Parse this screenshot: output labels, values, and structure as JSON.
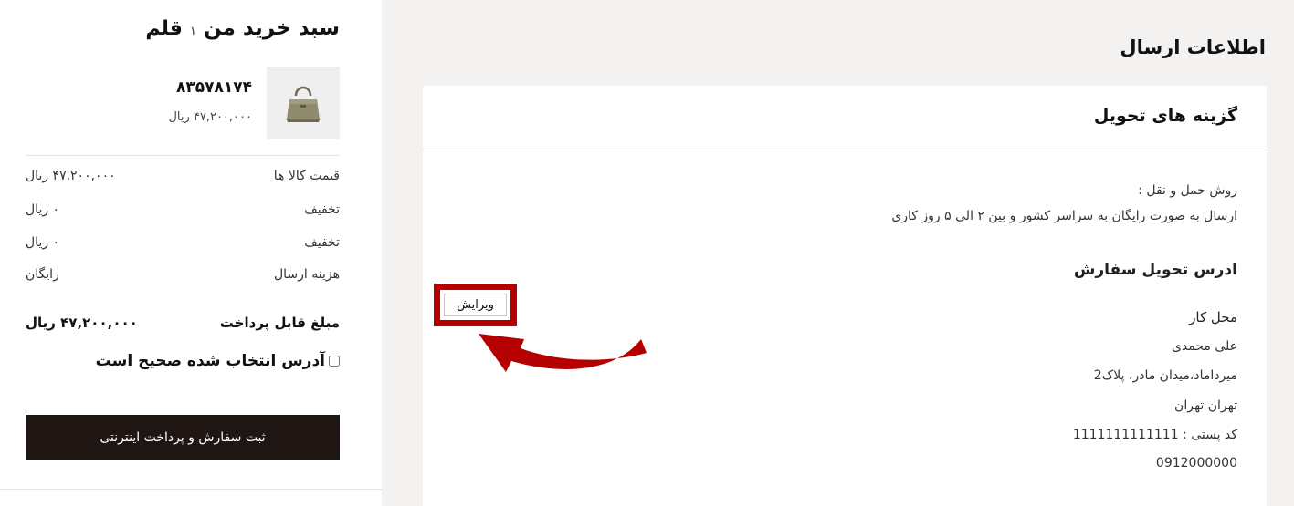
{
  "shipping": {
    "section_title": "اطلاعات ارسال",
    "card_title": "گزینه های تحویل",
    "method_label": "روش حمل و نقل :",
    "method_desc": "ارسال به صورت رایگان به سراسر کشور و بین ۲ الی ۵ روز کاری",
    "address_title": "ادرس تحویل سفارش",
    "address_lines": [
      "محل کار",
      "علی محمدی",
      "میرداماد،میدان مادر، پلاک2",
      "تهران تهران",
      "کد پستی : 1111111111111",
      "0912000000"
    ],
    "edit_label": "ویرایش"
  },
  "cart": {
    "title": "سبد خرید من",
    "count": "۱",
    "unit": "قلم",
    "product": {
      "code": "۸۳۵۷۸۱۷۴",
      "price": "۴۷,۲۰۰,۰۰۰ ریال",
      "thumb_icon": "handbag-icon"
    },
    "summary": [
      {
        "label": "قیمت کالا ها",
        "value": "۴۷,۲۰۰,۰۰۰ ریال"
      },
      {
        "label": "تخفیف",
        "value": "۰ ریال"
      },
      {
        "label": "تخفیف",
        "value": "۰ ریال"
      },
      {
        "label": "هزینه ارسال",
        "value": "رایگان"
      }
    ],
    "total_label": "مبلغ قابل پرداخت",
    "total_value": "۴۷,۲۰۰,۰۰۰ ریال",
    "confirm_label": "آدرس انتخاب شده صحیح است",
    "submit_label": "ثبت سفارش و پرداخت اینترنتی"
  },
  "colors": {
    "highlight": "#b40000",
    "button_bg": "#1f1614",
    "page_bg": "#f3f2f1"
  }
}
